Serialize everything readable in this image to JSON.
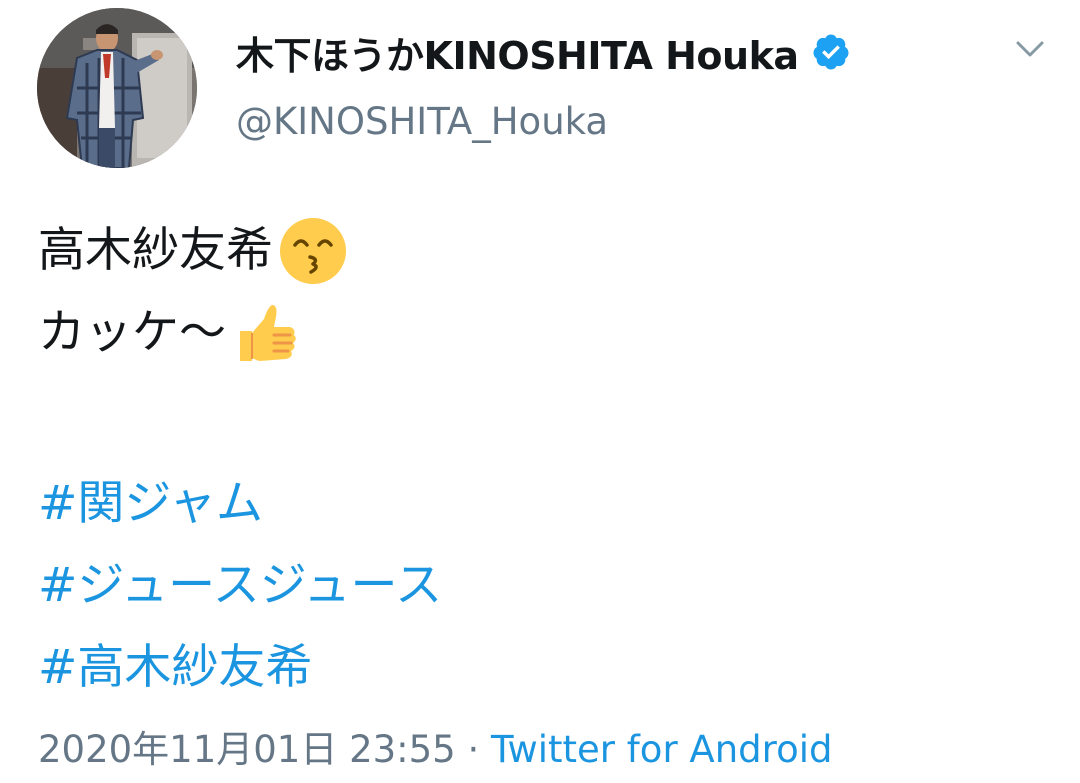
{
  "user": {
    "display_name": "木下ほうかKINOSHITA Houka",
    "handle": "@KINOSHITA_Houka",
    "verified": true,
    "avatar_icon": "profile-photo"
  },
  "menu": {
    "icon": "chevron-down-icon"
  },
  "tweet": {
    "lines": [
      {
        "text": "高木紗友希",
        "emoji": "kissing-face-with-smiling-eyes"
      },
      {
        "text": "カッケ〜",
        "emoji": "thumbs-up"
      }
    ],
    "hashtags": [
      "#関ジャム",
      "#ジュースジュース",
      "#高木紗友希"
    ],
    "timestamp": "2020年11月01日 23:55",
    "separator": " · ",
    "source": "Twitter for Android"
  },
  "colors": {
    "link": "#1b95e0",
    "secondary_text": "#657786",
    "primary_text": "#14171a",
    "verified_badge": "#1da1f2"
  }
}
